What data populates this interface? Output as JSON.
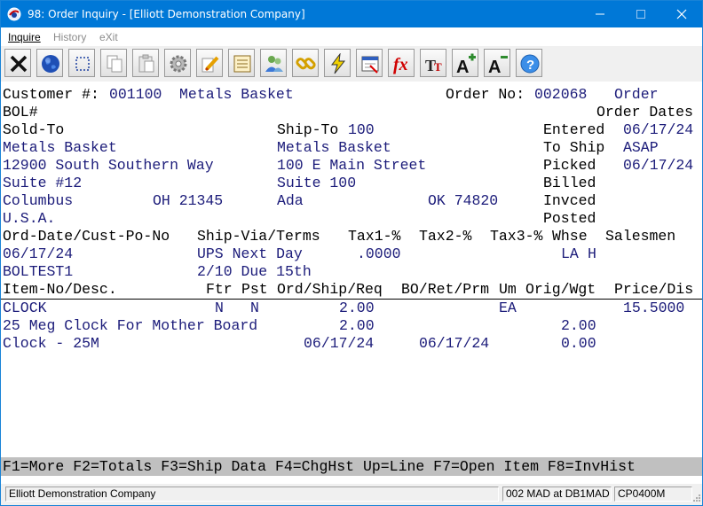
{
  "window": {
    "title": "98: Order Inquiry - [Elliott Demonstration Company]"
  },
  "menu": {
    "inquire": "Inquire",
    "history": "History",
    "exit": "eXit"
  },
  "toolbar_icons": [
    "close-icon",
    "globe-icon",
    "select-icon",
    "copy-icon",
    "paste-icon",
    "settings-icon",
    "edit-icon",
    "notes-icon",
    "users-icon",
    "link-icon",
    "lightning-icon",
    "window-icon",
    "function-icon",
    "font-icon",
    "font-increase-icon",
    "font-decrease-icon",
    "help-icon"
  ],
  "header": {
    "customer_label": "Customer #:",
    "customer_no": "001100",
    "customer_name": "Metals Basket",
    "order_no_label": "Order No:",
    "order_no": "002068",
    "order_type": "Order",
    "bol_label": "BOL#",
    "order_dates_label": "Order Dates"
  },
  "sold_to": {
    "label": "Sold-To",
    "name": "Metals Basket",
    "address1": "12900 South Southern Way",
    "address2": "Suite #12",
    "city": "Columbus",
    "state_zip": "OH 21345",
    "country": "U.S.A."
  },
  "ship_to": {
    "label": "Ship-To",
    "code": "100",
    "name": "Metals Basket",
    "address1": "100 E Main Street",
    "address2": "Suite 100",
    "city": "Ada",
    "state_zip": "OK 74820"
  },
  "dates": {
    "entered_label": "Entered",
    "entered": "06/17/24",
    "to_ship_label": "To Ship",
    "to_ship": "ASAP",
    "picked_label": "Picked",
    "picked": "06/17/24",
    "billed_label": "Billed",
    "invced_label": "Invced",
    "posted_label": "Posted"
  },
  "order_info": {
    "headers": {
      "ord_date_po": "Ord-Date/Cust-Po-No",
      "ship_via_terms": "Ship-Via/Terms",
      "tax1": "Tax1-%",
      "tax2": "Tax2-%",
      "tax3": "Tax3-%",
      "whse": "Whse",
      "salesmen": "Salesmen"
    },
    "ord_date": "06/17/24",
    "ship_via": "UPS Next Day",
    "tax1": ".0000",
    "whse": "LA",
    "salesmen": "H",
    "cust_po": "BOLTEST1",
    "terms": "2/10 Due 15th"
  },
  "line_headers": {
    "item": "Item-No/Desc.",
    "ftr": "Ftr",
    "pst": "Pst",
    "ord_ship_req": "Ord/Ship/Req",
    "bo_ret_prm": "BO/Ret/Prm",
    "um": "Um",
    "orig_wgt": "Orig/Wgt",
    "price_dis": "Price/Dis"
  },
  "line_item": {
    "item_no": "CLOCK",
    "ftr": "N",
    "pst": "N",
    "ord_qty": "2.00",
    "um": "EA",
    "price": "15.5000",
    "desc1": "25 Meg Clock For Mother Board",
    "ship_qty": "2.00",
    "orig": "2.00",
    "desc2": "Clock - 25M",
    "req_date": "06/17/24",
    "prm_date": "06/17/24",
    "wgt": "0.00"
  },
  "fkeys": "F1=More F2=Totals F3=Ship Data F4=ChgHst Up=Line F7=Open Item F8=InvHist",
  "status": {
    "company": "Elliott Demonstration Company",
    "location": "002 MAD at DB1MAD",
    "program": "CP0400M"
  }
}
